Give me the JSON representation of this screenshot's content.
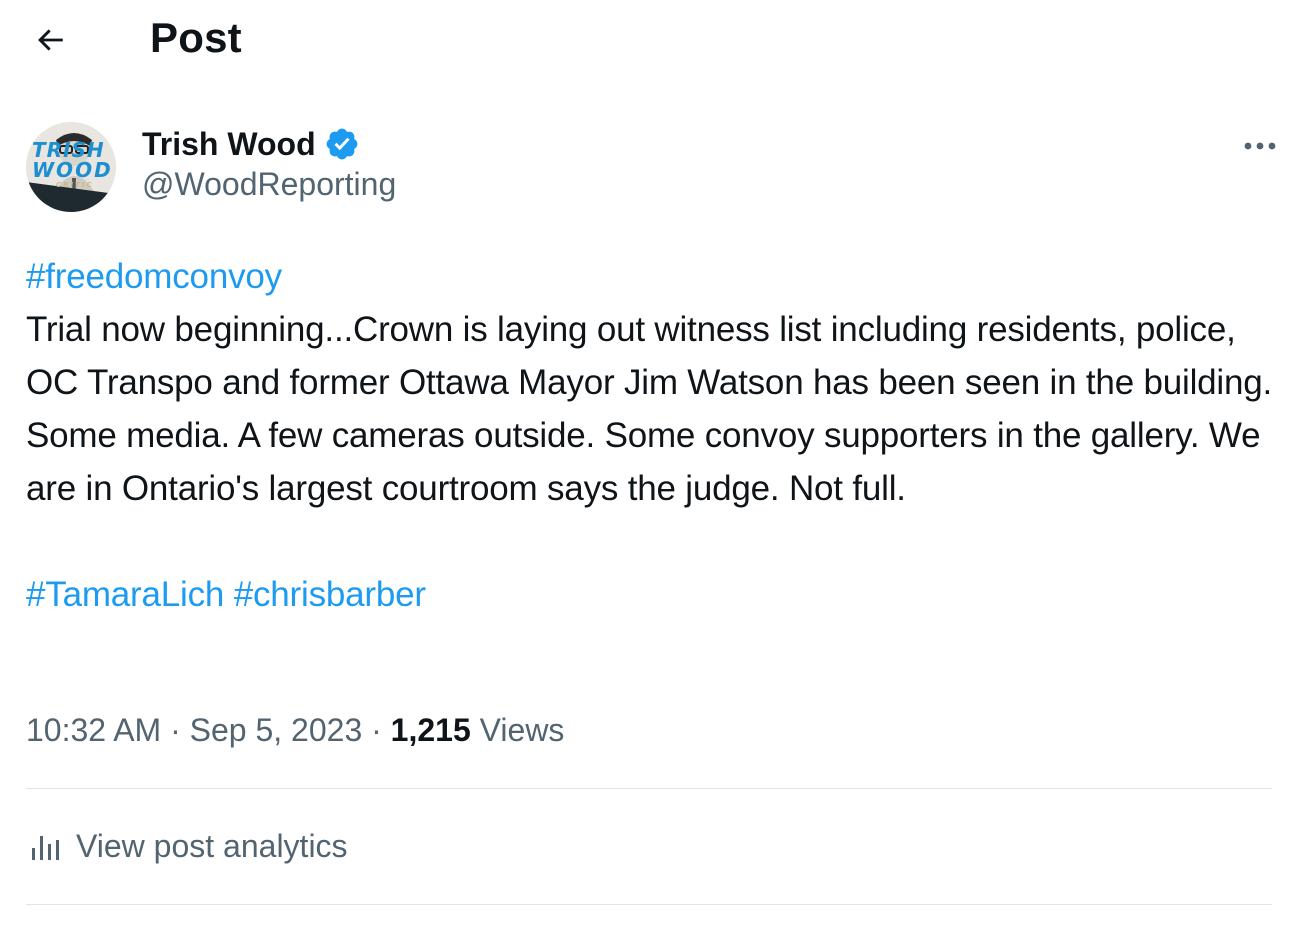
{
  "header": {
    "title": "Post",
    "back_icon": "arrow-left-icon"
  },
  "author": {
    "name": "Trish Wood",
    "handle": "@WoodReporting",
    "verified": true,
    "verified_color": "#1d9bf0",
    "avatar_text_line1": "TRISH",
    "avatar_text_line2": "WOOD",
    "avatar_text_line3": "CRITIC"
  },
  "post": {
    "hashtag_top": "#freedomconvoy",
    "text": "Trial now beginning...Crown is laying out witness list including residents, police, OC Transpo and former Ottawa Mayor Jim Watson has been seen in the building. Some media. A few cameras outside. Some convoy supporters in the gallery. We are in Ontario's largest courtroom says the judge. Not full.",
    "hashtags_bottom": [
      "#TamaraLich",
      "#chrisbarber"
    ]
  },
  "meta": {
    "time": "10:32 AM",
    "separator": "·",
    "date": "Sep 5, 2023",
    "views_count": "1,215",
    "views_label": "Views"
  },
  "analytics": {
    "label": "View post analytics",
    "icon": "bar-chart-icon"
  },
  "colors": {
    "accent": "#1d9bf0",
    "text_primary": "#0f1419",
    "text_secondary": "#536471",
    "divider": "#dfe5e9"
  }
}
